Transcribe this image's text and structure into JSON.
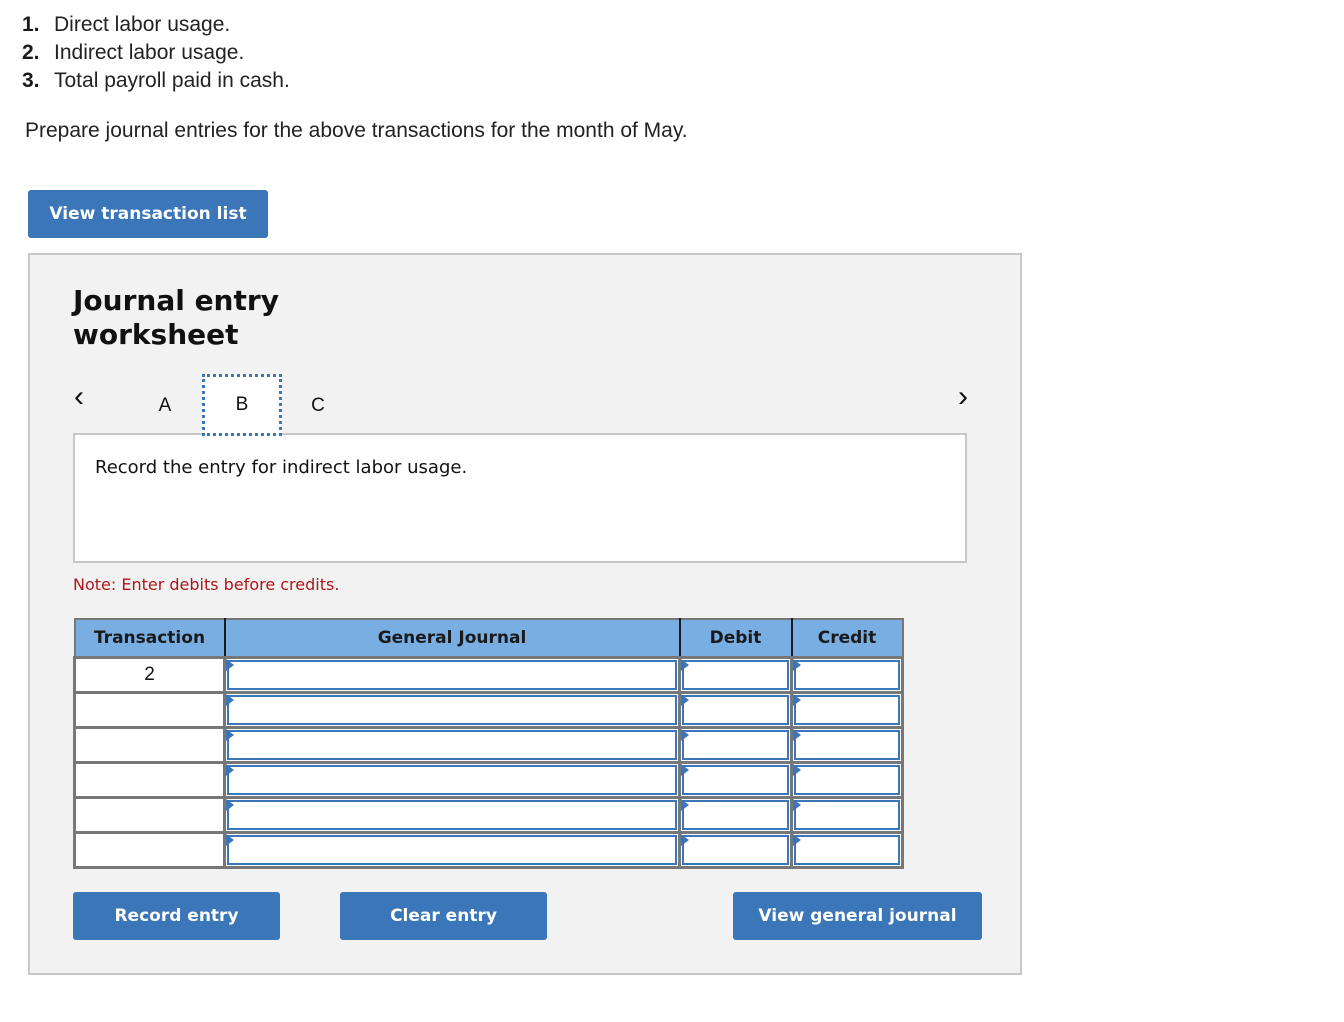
{
  "questions": [
    {
      "number": "1.",
      "text": "Direct labor usage."
    },
    {
      "number": "2.",
      "text": "Indirect labor usage."
    },
    {
      "number": "3.",
      "text": "Total payroll paid in cash."
    }
  ],
  "prompt": "Prepare journal entries for the above transactions for the month of May.",
  "buttons": {
    "view_transaction_list": "View transaction list",
    "record_entry": "Record entry",
    "clear_entry": "Clear entry",
    "view_general_journal": "View general journal"
  },
  "worksheet": {
    "title": "Journal entry worksheet",
    "nav": {
      "prev_icon": "‹",
      "next_icon": "›"
    },
    "tabs": [
      {
        "label": "A",
        "active": false
      },
      {
        "label": "B",
        "active": true
      },
      {
        "label": "C",
        "active": false
      }
    ],
    "instruction": "Record the entry for indirect labor usage.",
    "note": "Note: Enter debits before credits.",
    "table": {
      "headers": [
        "Transaction",
        "General Journal",
        "Debit",
        "Credit"
      ],
      "rows": [
        {
          "transaction": "2",
          "account": "",
          "debit": "",
          "credit": ""
        },
        {
          "transaction": "",
          "account": "",
          "debit": "",
          "credit": ""
        },
        {
          "transaction": "",
          "account": "",
          "debit": "",
          "credit": ""
        },
        {
          "transaction": "",
          "account": "",
          "debit": "",
          "credit": ""
        },
        {
          "transaction": "",
          "account": "",
          "debit": "",
          "credit": ""
        },
        {
          "transaction": "",
          "account": "",
          "debit": "",
          "credit": ""
        }
      ]
    }
  },
  "colors": {
    "button_blue": "#3a76b8",
    "header_blue": "#79aee3",
    "note_red": "#b0151b",
    "panel_bg": "#f2f2f2"
  }
}
